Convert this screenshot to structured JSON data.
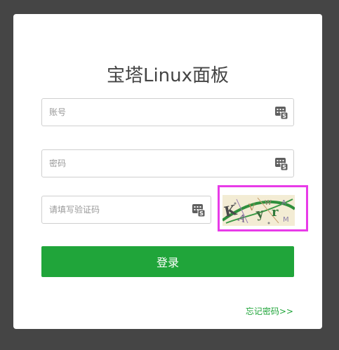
{
  "title": "宝塔Linux面板",
  "username": {
    "value": "",
    "placeholder": "账号"
  },
  "password": {
    "value": "",
    "placeholder": "密码"
  },
  "captcha": {
    "value": "",
    "placeholder": "请填写验证码",
    "image_text": "KAVyr"
  },
  "login_button": "登录",
  "forgot_link": "忘记密码>>",
  "colors": {
    "background": "#454545",
    "card": "#ffffff",
    "accent": "#20a53a",
    "highlight": "#e83be8"
  },
  "icons": {
    "keyboard": "soft-keyboard-icon"
  }
}
